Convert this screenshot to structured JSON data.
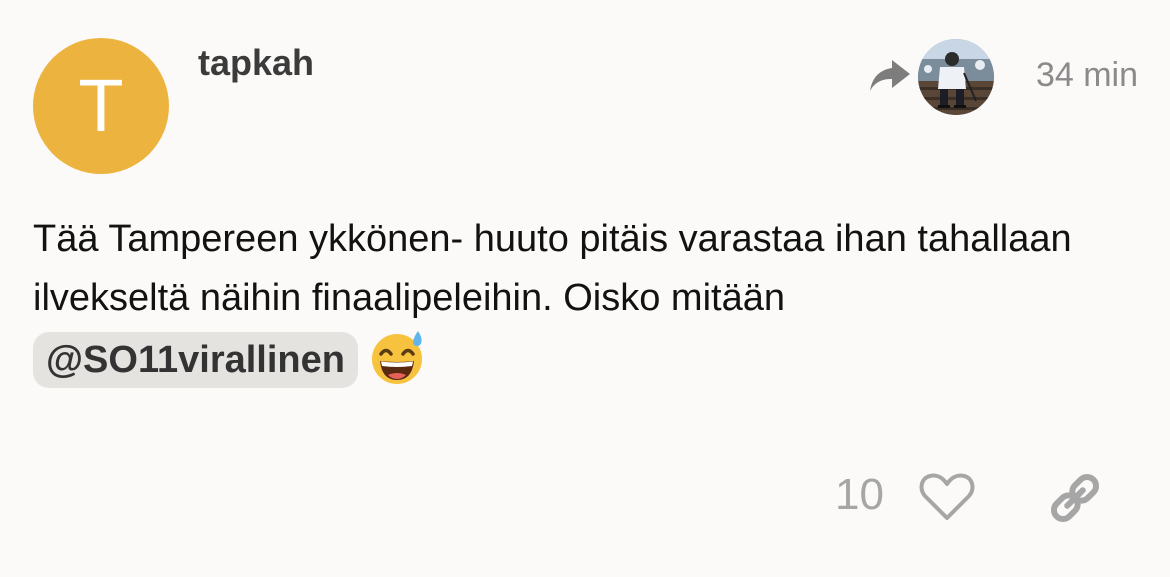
{
  "post": {
    "avatar_letter": "T",
    "username": "tapkah",
    "timestamp": "34 min",
    "body_text": "Tää Tampereen ykkönen- huuto pitäis varastaa ihan tahallaan ilvekseltä näihin finaalipeleihin. Oisko mitään",
    "mention": "@SO11virallinen",
    "emoji": "grinning-face-with-sweat",
    "like_count": "10"
  },
  "colors": {
    "avatar": "#ecb33f",
    "background": "#fbfaf8",
    "muted": "#a6a6a6",
    "mention_bg": "#e5e3e0"
  },
  "icons": {
    "reply": "reply-arrow-icon",
    "like": "heart-outline-icon",
    "share": "link-icon"
  }
}
